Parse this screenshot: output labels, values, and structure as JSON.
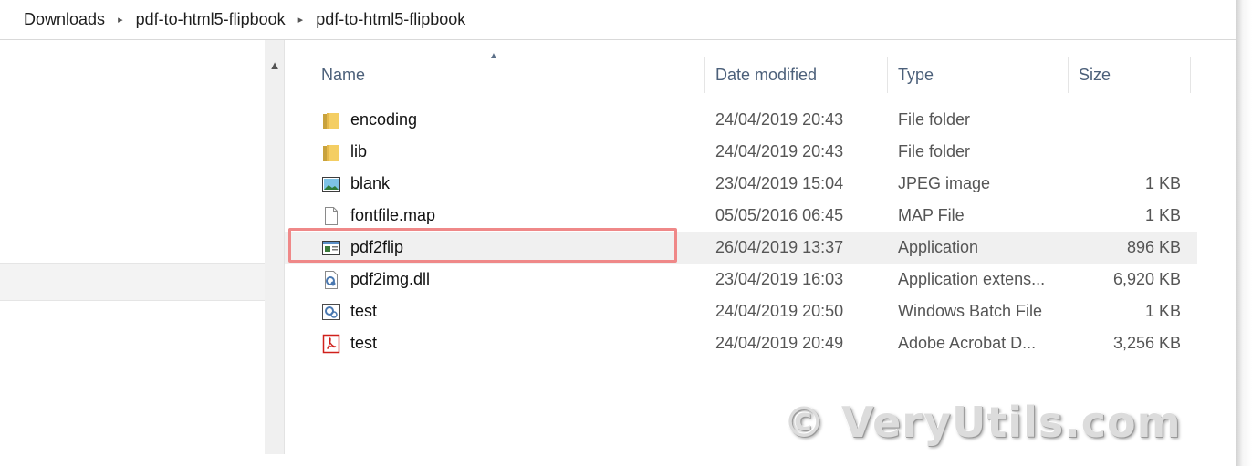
{
  "breadcrumb": {
    "items": [
      "Downloads",
      "pdf-to-html5-flipbook",
      "pdf-to-html5-flipbook"
    ],
    "separator": "▸"
  },
  "columns": {
    "name": "Name",
    "date": "Date modified",
    "type": "Type",
    "size": "Size"
  },
  "files": [
    {
      "name": "encoding",
      "date": "24/04/2019 20:43",
      "type": "File folder",
      "size": "",
      "icon": "folder-icon"
    },
    {
      "name": "lib",
      "date": "24/04/2019 20:43",
      "type": "File folder",
      "size": "",
      "icon": "folder-icon"
    },
    {
      "name": "blank",
      "date": "23/04/2019 15:04",
      "type": "JPEG image",
      "size": "1 KB",
      "icon": "image-file-icon"
    },
    {
      "name": "fontfile.map",
      "date": "05/05/2016 06:45",
      "type": "MAP File",
      "size": "1 KB",
      "icon": "blank-file-icon"
    },
    {
      "name": "pdf2flip",
      "date": "26/04/2019 13:37",
      "type": "Application",
      "size": "896 KB",
      "icon": "application-icon"
    },
    {
      "name": "pdf2img.dll",
      "date": "23/04/2019 16:03",
      "type": "Application extens...",
      "size": "6,920 KB",
      "icon": "dll-file-icon"
    },
    {
      "name": "test",
      "date": "24/04/2019 20:50",
      "type": "Windows Batch File",
      "size": "1 KB",
      "icon": "batch-file-icon"
    },
    {
      "name": "test",
      "date": "24/04/2019 20:49",
      "type": "Adobe Acrobat D...",
      "size": "3,256 KB",
      "icon": "pdf-file-icon"
    }
  ],
  "watermark": "© VeryUtils.com",
  "colors": {
    "header_text": "#4c607a",
    "highlight_border": "#ef8888",
    "selected_row": "#f0f0f0"
  }
}
